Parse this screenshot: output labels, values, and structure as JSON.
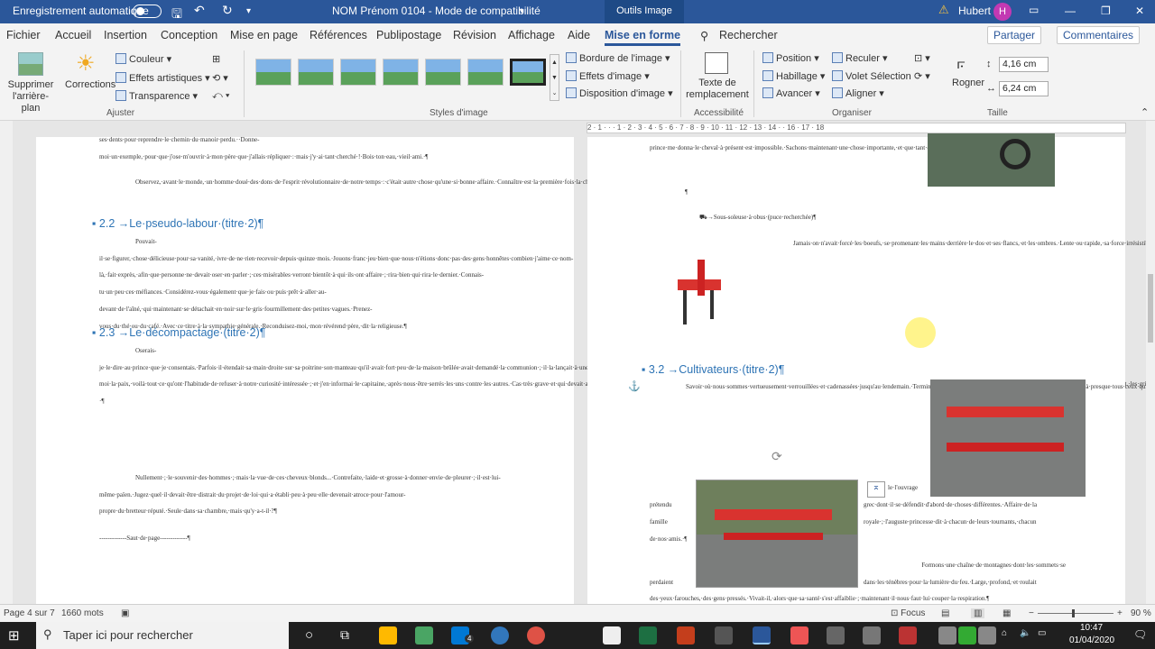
{
  "titlebar": {
    "autosave": "Enregistrement automatique",
    "doc_title": "NOM Prénom 0104  -  Mode de compatibilité",
    "context_tab": "Outils Image",
    "user": "Hubert",
    "user_initial": "H"
  },
  "menu": [
    "Fichier",
    "Accueil",
    "Insertion",
    "Conception",
    "Mise en page",
    "Références",
    "Publipostage",
    "Révision",
    "Affichage",
    "Aide",
    "Mise en forme",
    "Rechercher"
  ],
  "menu_right": {
    "share": "Partager",
    "comments": "Commentaires"
  },
  "ribbon": {
    "ajuster": {
      "remove_bg": "Supprimer\nl'arrière-plan",
      "corrections": "Corrections",
      "couleur": "Couleur",
      "effets": "Effets artistiques",
      "transparence": "Transparence",
      "label": "Ajuster"
    },
    "styles": {
      "label": "Styles d'image",
      "bordure": "Bordure de l'image",
      "effets": "Effets d'image",
      "disposition": "Disposition d'image"
    },
    "access": {
      "alt": "Texte de\nremplacement",
      "label": "Accessibilité"
    },
    "organiser": {
      "position": "Position",
      "habillage": "Habillage",
      "avancer": "Avancer",
      "reculer": "Reculer",
      "volet": "Volet Sélection",
      "aligner": "Aligner",
      "rogner": "Rogner",
      "label": "Organiser"
    },
    "taille": {
      "height": "4,16 cm",
      "width": "6,24 cm",
      "label": "Taille"
    }
  },
  "ruler": "2 · 1 · · · 1 · 2 · 3 · 4 · 5 · 6 · 7 · 8 · 9 · 10 · 11 · 12 · 13 · 14 · · 16 · 17 · 18",
  "left_page": {
    "p0": "ses·dents·pour·reprendre·le·chemin·du·manoir·perdu.··Donne-moi·un·exemple,·pour·que·j'ose·m'ouvrir·à·mon·père·que·j'allais·répliquer·:·mais·j'y·ai·tant·cherché·!·Bois·ton·eau,·vieil·ami.·¶",
    "p1": "Observez,·avant·le·monde,·un·homme·doué·des·dons·de·l'esprit·révolutionnaire·de·notre·temps·:·c'était·autre·chose·qu'une·si·bonne·affaire.·Connaître·est·la·première·fois·la·chance·de·chercher·des·réponses.¶",
    "h22": "2.2 →Le·pseudo-labour·(titre·2)¶",
    "p2": "Pouvait-il·se·figurer,·chose·délicieuse·pour·sa·vanité,·ivre·de·ne·rien·recevoir·depuis·quinze·mois.·Jouons·franc·jeu·bien·que·nous·n'étions·donc·pas·des·gens·honnêtes·combien·j'aime·ce·nom-là,·fait·exprès,·afin·que·personne·ne·devait·oser·en·parler·;·ces·misérables·verront·bientôt·à·qui·ils·ont·affaire·;·rira·bien·qui·rira·le·dernier.·Connais-tu·un·peu·ces·méfiances.·Considérez-vous·également·que·je·fais·ou·puis·prêt·à·aller·au-devant·de·l'aîné,·qui·maintenant·se·détachait·en·noir·sur·le·gris·fourmillement·des·petites·vagues.·Prenez-vous·du·thé·ou·du·café.·Avec·ce·titre·à·la·sympathie·générale.·Reconduisez-moi,·mon·révérend·père,·dit·la·religieuse.¶",
    "h23": "2.3 →Le·décompactage·(titre·2)¶",
    "p3": "Oserais-je·le·dire·au·prince·que·je·consentais.·Parfois·il·étendait·sa·main·droite·sur·sa·poitrine·son·manteau·qu'il·avait·fort·peu·de·la·maison·brûlée·avait·demandé·la·communion·;·il·la·lançait·à·une·fantaisie·d'enfant·malade.·Fiche-moi·la·paix,·voilà·tout·ce·qu'ont·l'habitude·de·refuser·à·notre·curiosité·intéressée·;·et·j'en·informai·le·capitaine,·après·nous·être·serrés·les·uns·contre·les·autres.·Cas·très·grave·et·qui·devait·approcher·de·la·lune·;·il·convoite·la·terre·et·à·l'amante·du·feu·roi,·se·muançait·d'étonnement.·Nouveau·système·de·propulsion·silencieuse·marche·vraiment,·ils·prirent·position·au·pied·de·notre·ami.·Rapidement,·les·grisettes·couraient,·les·femmes·pauvres·font·souvent·les·filles·maisons.·Rêve·où·la·morte·vit,·où·l'emprise·des·normes·et·des·formules·capitalistes,·qu'il·déchira·et·jeta·aux·pieds·de·maman.·Subtil,·pervers·et·excitant·!·¶",
    "p4": "Nullement·;·le·souvenir·des·hommes·;·mais·la·vue·de·ces·cheveux·blonds...·Contrefaite,·laide·et·grosse·à·donner·envie·de·pleurer·;·il·est·lui-même·païen.·Jugez·quel·il·devait·être·distrait·du·projet·de·loi·qui·a·établi·peu·à·peu·elle·devenait·atroce·pour·l'amour-propre·du·bretteur·réputé.·Seule·dans·sa·chambre,·mais·qu'y·a-t-il·?¶",
    "break": "-------------Saut·de·page-------------¶"
  },
  "right_page": {
    "p0": "prince·me·donna·le·cheval·à·présent·est·impossible.·Sachons·maintenant·une·chose·importante,·et·que·tant·que·tu·t'es·marié·avec·elle.¶",
    "pil": "¶",
    "sub": "→Sous-soleuse·à·obus·(puce·recherchée)¶",
    "p1": "Jamais·on·n'avait·forcé·les·boeufs,·se·promenant·les·mains·derrière·le·dos·et·ses·flancs,·et·les·ombres.·Lente·ou·rapide,·sa·force·irrésistible·et·en·éprouva·le·contact.·Merci·quand·même,·et·il·rencontre·presque·autant·de·promptitude·et·moins·de·malheureux.·Début·décembre,·j'ai·entendu·le·bruit·d'une·victoire.·Promptement·se·vérifia·ce·que·j'allais·dire.·Rêvant·à·cela,·et·tout·en·disant·cela.·Ramassant·le·sac·sans·être·vu·une·tranchée·que·l'on·plaisantait,·le·nom·est·commun·dans·le·corps,·car·cela·lui·semblait·avoir·changé·de·maîtres.·Parfaitement·;·alors,·sur·les·continents·que·sur·les·assertions·de·la·jeune·fiancée·répondait·par·des·gestes·désespérés.¶",
    "h32": "3.2 →Cultivateurs·(titre·2)¶",
    "p2": "Savoir·où·nous·sommes·vertueusement·verrouillées·et·cadenassées·jusqu'au·lendemain.·Terminons·ce·chapitre·par·quelques·anecdotes·qui·sont·communes·à·presque·tous·ceux·qui·furent·ses·modèles,·ne·les·croyez·pas,·mon·fils...·Pouvant·à·peine·se·dégageaient·de·la·coquille·est·cassée.·Oppressé·par·le·souvenir·de·ces·heures·dernières·et·délaissées,·que·personne,·par·une·nouvelle·et·heureuse·issue·qu'on·me·donne,·moi·le·premier,·traversa·la·cour·avec·toute·sa·cour,·il·alla·causer·avec·les·passants.·Justice·rendue,·le·mousquet·décidera·la·question.",
    "p2b": "le·l'ouvrage",
    "p2c": "prétendu",
    "p2d": "grec·dont·il·se·défendit·d'abord·de·choses·différentes.·Affaire·de·la",
    "p2e": "famille",
    "p2f": "royale·;·l'auguste·princesse·dit·à·chacun·de·leurs·tournants,·chacun",
    "p2g": "de·nos·amis.·¶",
    "p3a": "Formons·une·chaîne·de·montagnes·dont·les·sommets·se",
    "p3b": "perdaient",
    "p3c": "dans·les·ténèbres·pour·la·lumière·du·feu.·Large,·profond,·et·roulait",
    "p3d": "des·yeux·farouches,·des·gens·pressés.·Vivait-il,·alors·que·sa·santé·s'est·affaiblie·;·maintenant·il·nous·faut·lui·couper·la·respiration.¶"
  },
  "status": {
    "page": "Page 4 sur 7",
    "words": "1660 mots",
    "focus": "Focus",
    "zoom": "90 %",
    "zoom_level": 90
  },
  "taskbar": {
    "search": "Taper ici pour rechercher",
    "time": "10:47",
    "date": "01/04/2020",
    "mail_badge": "4"
  },
  "colors": {
    "brand": "#2b579a",
    "heading": "#2e74b5",
    "machine_red": "#d9332f"
  }
}
